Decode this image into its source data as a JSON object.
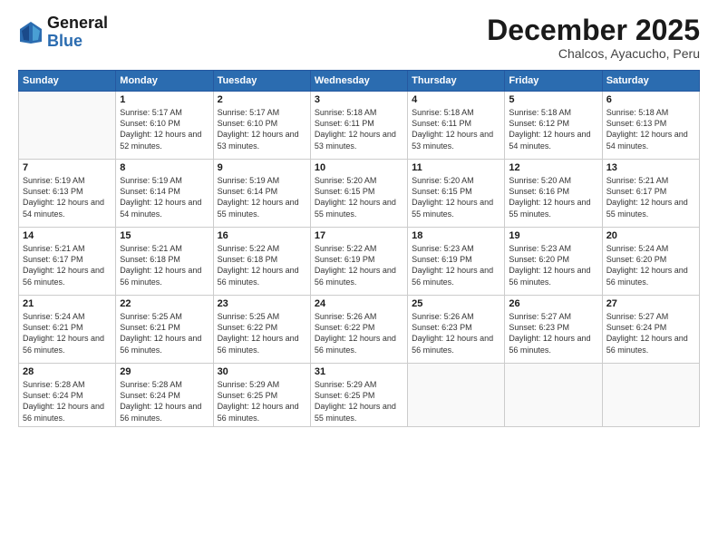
{
  "logo": {
    "line1": "General",
    "line2": "Blue"
  },
  "header": {
    "title": "December 2025",
    "subtitle": "Chalcos, Ayacucho, Peru"
  },
  "days_of_week": [
    "Sunday",
    "Monday",
    "Tuesday",
    "Wednesday",
    "Thursday",
    "Friday",
    "Saturday"
  ],
  "weeks": [
    [
      {
        "day": "",
        "info": ""
      },
      {
        "day": "1",
        "info": "Sunrise: 5:17 AM\nSunset: 6:10 PM\nDaylight: 12 hours\nand 52 minutes."
      },
      {
        "day": "2",
        "info": "Sunrise: 5:17 AM\nSunset: 6:10 PM\nDaylight: 12 hours\nand 53 minutes."
      },
      {
        "day": "3",
        "info": "Sunrise: 5:18 AM\nSunset: 6:11 PM\nDaylight: 12 hours\nand 53 minutes."
      },
      {
        "day": "4",
        "info": "Sunrise: 5:18 AM\nSunset: 6:11 PM\nDaylight: 12 hours\nand 53 minutes."
      },
      {
        "day": "5",
        "info": "Sunrise: 5:18 AM\nSunset: 6:12 PM\nDaylight: 12 hours\nand 54 minutes."
      },
      {
        "day": "6",
        "info": "Sunrise: 5:18 AM\nSunset: 6:13 PM\nDaylight: 12 hours\nand 54 minutes."
      }
    ],
    [
      {
        "day": "7",
        "info": "Sunrise: 5:19 AM\nSunset: 6:13 PM\nDaylight: 12 hours\nand 54 minutes."
      },
      {
        "day": "8",
        "info": "Sunrise: 5:19 AM\nSunset: 6:14 PM\nDaylight: 12 hours\nand 54 minutes."
      },
      {
        "day": "9",
        "info": "Sunrise: 5:19 AM\nSunset: 6:14 PM\nDaylight: 12 hours\nand 55 minutes."
      },
      {
        "day": "10",
        "info": "Sunrise: 5:20 AM\nSunset: 6:15 PM\nDaylight: 12 hours\nand 55 minutes."
      },
      {
        "day": "11",
        "info": "Sunrise: 5:20 AM\nSunset: 6:15 PM\nDaylight: 12 hours\nand 55 minutes."
      },
      {
        "day": "12",
        "info": "Sunrise: 5:20 AM\nSunset: 6:16 PM\nDaylight: 12 hours\nand 55 minutes."
      },
      {
        "day": "13",
        "info": "Sunrise: 5:21 AM\nSunset: 6:17 PM\nDaylight: 12 hours\nand 55 minutes."
      }
    ],
    [
      {
        "day": "14",
        "info": "Sunrise: 5:21 AM\nSunset: 6:17 PM\nDaylight: 12 hours\nand 56 minutes."
      },
      {
        "day": "15",
        "info": "Sunrise: 5:21 AM\nSunset: 6:18 PM\nDaylight: 12 hours\nand 56 minutes."
      },
      {
        "day": "16",
        "info": "Sunrise: 5:22 AM\nSunset: 6:18 PM\nDaylight: 12 hours\nand 56 minutes."
      },
      {
        "day": "17",
        "info": "Sunrise: 5:22 AM\nSunset: 6:19 PM\nDaylight: 12 hours\nand 56 minutes."
      },
      {
        "day": "18",
        "info": "Sunrise: 5:23 AM\nSunset: 6:19 PM\nDaylight: 12 hours\nand 56 minutes."
      },
      {
        "day": "19",
        "info": "Sunrise: 5:23 AM\nSunset: 6:20 PM\nDaylight: 12 hours\nand 56 minutes."
      },
      {
        "day": "20",
        "info": "Sunrise: 5:24 AM\nSunset: 6:20 PM\nDaylight: 12 hours\nand 56 minutes."
      }
    ],
    [
      {
        "day": "21",
        "info": "Sunrise: 5:24 AM\nSunset: 6:21 PM\nDaylight: 12 hours\nand 56 minutes."
      },
      {
        "day": "22",
        "info": "Sunrise: 5:25 AM\nSunset: 6:21 PM\nDaylight: 12 hours\nand 56 minutes."
      },
      {
        "day": "23",
        "info": "Sunrise: 5:25 AM\nSunset: 6:22 PM\nDaylight: 12 hours\nand 56 minutes."
      },
      {
        "day": "24",
        "info": "Sunrise: 5:26 AM\nSunset: 6:22 PM\nDaylight: 12 hours\nand 56 minutes."
      },
      {
        "day": "25",
        "info": "Sunrise: 5:26 AM\nSunset: 6:23 PM\nDaylight: 12 hours\nand 56 minutes."
      },
      {
        "day": "26",
        "info": "Sunrise: 5:27 AM\nSunset: 6:23 PM\nDaylight: 12 hours\nand 56 minutes."
      },
      {
        "day": "27",
        "info": "Sunrise: 5:27 AM\nSunset: 6:24 PM\nDaylight: 12 hours\nand 56 minutes."
      }
    ],
    [
      {
        "day": "28",
        "info": "Sunrise: 5:28 AM\nSunset: 6:24 PM\nDaylight: 12 hours\nand 56 minutes."
      },
      {
        "day": "29",
        "info": "Sunrise: 5:28 AM\nSunset: 6:24 PM\nDaylight: 12 hours\nand 56 minutes."
      },
      {
        "day": "30",
        "info": "Sunrise: 5:29 AM\nSunset: 6:25 PM\nDaylight: 12 hours\nand 56 minutes."
      },
      {
        "day": "31",
        "info": "Sunrise: 5:29 AM\nSunset: 6:25 PM\nDaylight: 12 hours\nand 55 minutes."
      },
      {
        "day": "",
        "info": ""
      },
      {
        "day": "",
        "info": ""
      },
      {
        "day": "",
        "info": ""
      }
    ]
  ]
}
